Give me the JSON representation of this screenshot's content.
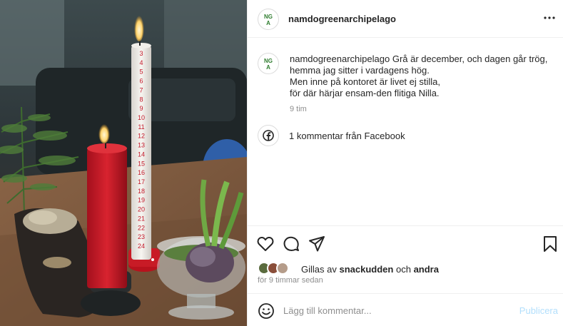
{
  "post": {
    "username": "namdogreenarchipelago",
    "avatar_text_line1": "NG",
    "avatar_text_line2": "A",
    "more_icon": "more-horizontal-icon"
  },
  "caption": {
    "username": "namdogreenarchipelago",
    "text_line1": "Grå är december, och dagen går trög,",
    "text_line2": "hemma jag sitter i vardagens hög.",
    "text_line3": "Men inne på kontoret är livet ej stilla,",
    "text_line4": "för där härjar ensam-den flitiga Nilla.",
    "time": "9 tim"
  },
  "facebook": {
    "icon": "facebook-icon",
    "text": "1 kommentar från Facebook"
  },
  "actions": {
    "like_icon": "heart-icon",
    "comment_icon": "comment-icon",
    "share_icon": "share-icon",
    "save_icon": "bookmark-icon"
  },
  "likes": {
    "prefix": "Gillas av",
    "user": "snackudden",
    "conjunction": "och",
    "others": "andra"
  },
  "timestamp": "för 9 timmar sedan",
  "comment": {
    "placeholder": "Lägg till kommentar...",
    "publish_label": "Publicera",
    "emoji_icon": "emoji-icon"
  },
  "photo": {
    "calendar_numbers": [
      "3",
      "4",
      "5",
      "6",
      "7",
      "8",
      "9",
      "10",
      "11",
      "12",
      "13",
      "14",
      "15",
      "16",
      "17",
      "18",
      "19",
      "20",
      "21",
      "22",
      "23",
      "24"
    ]
  },
  "colors": {
    "text": "#262626",
    "muted": "#8e8e8e",
    "publish_disabled": "#b2dffc",
    "candle_red": "#c3192a",
    "brand_green": "#2f7d2f"
  }
}
